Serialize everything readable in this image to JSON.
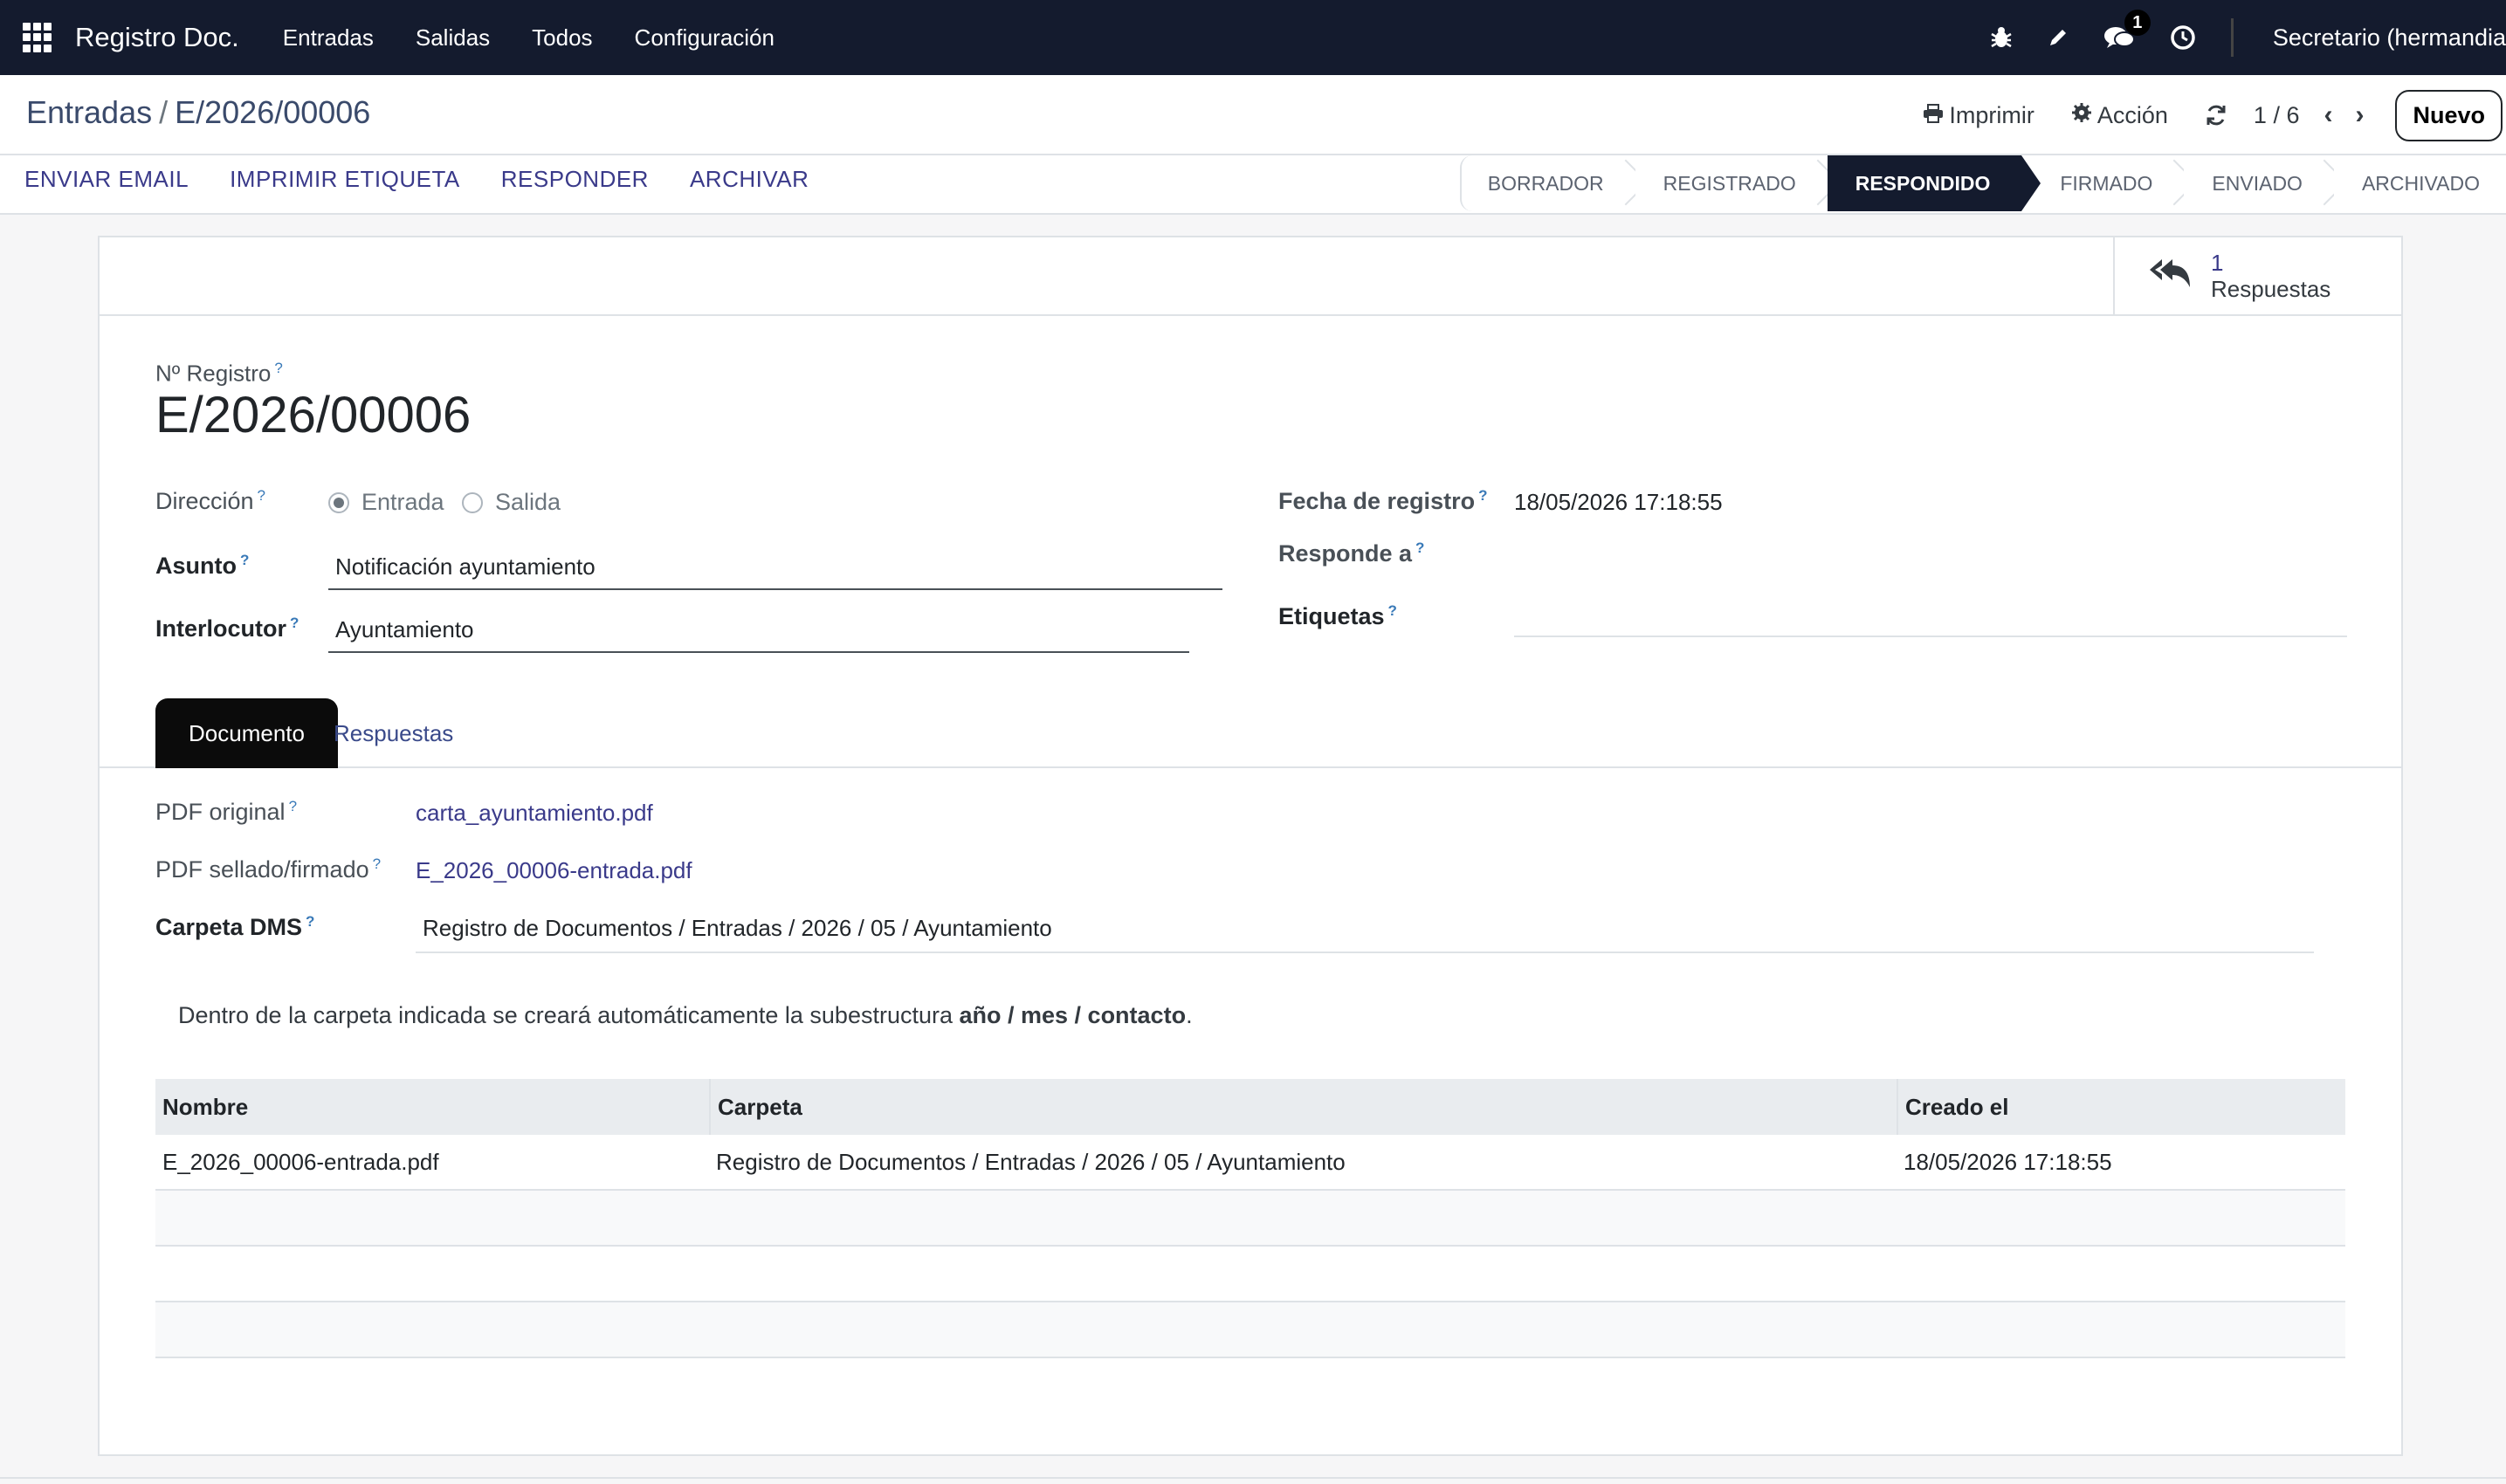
{
  "navbar": {
    "brand": "Registro Doc.",
    "menu": [
      "Entradas",
      "Salidas",
      "Todos",
      "Configuración"
    ],
    "messages_badge": "1",
    "user": "Secretario (hermandia"
  },
  "breadcrumb": {
    "parent": "Entradas",
    "separator": "/",
    "current": "E/2026/00006"
  },
  "actions": {
    "print": "Imprimir",
    "action": "Acción",
    "pager": "1 / 6",
    "new": "Nuevo"
  },
  "header_buttons": [
    "ENVIAR EMAIL",
    "IMPRIMIR ETIQUETA",
    "RESPONDER",
    "ARCHIVAR"
  ],
  "stages": [
    "BORRADOR",
    "REGISTRADO",
    "RESPONDIDO",
    "FIRMADO",
    "ENVIADO",
    "ARCHIVADO"
  ],
  "active_stage": "RESPONDIDO",
  "smart_button": {
    "count": "1",
    "label": "Respuestas"
  },
  "form": {
    "registro_label": "Nº Registro",
    "registro_value": "E/2026/00006",
    "direccion_label": "Dirección",
    "direccion_options": [
      "Entrada",
      "Salida"
    ],
    "direccion_selected": "Entrada",
    "asunto_label": "Asunto",
    "asunto_value": "Notificación ayuntamiento",
    "interlocutor_label": "Interlocutor",
    "interlocutor_value": "Ayuntamiento",
    "fecha_label": "Fecha de registro",
    "fecha_value": "18/05/2026 17:18:55",
    "responde_label": "Responde a",
    "etiquetas_label": "Etiquetas",
    "help_mark": "?"
  },
  "tabs": [
    "Documento",
    "Respuestas"
  ],
  "documento": {
    "pdf_original_label": "PDF original",
    "pdf_original_value": "carta_ayuntamiento.pdf",
    "pdf_sellado_label": "PDF sellado/firmado",
    "pdf_sellado_value": "E_2026_00006-entrada.pdf",
    "carpeta_label": "Carpeta DMS",
    "carpeta_value": "Registro de Documentos / Entradas / 2026 / 05 / Ayuntamiento",
    "note_prefix": "Dentro de la carpeta indicada se creará automáticamente la subestructura ",
    "note_bold": "año / mes / contacto",
    "note_suffix": "."
  },
  "table": {
    "columns": [
      "Nombre",
      "Carpeta",
      "Creado el"
    ],
    "rows": [
      [
        "E_2026_00006-entrada.pdf",
        "Registro de Documentos / Entradas / 2026 / 05 / Ayuntamiento",
        "18/05/2026 17:18:55"
      ]
    ]
  },
  "colors": {
    "navbar_bg": "#141b2e",
    "active_stage_bg": "#141b2e",
    "link": "#3a3a8a"
  }
}
